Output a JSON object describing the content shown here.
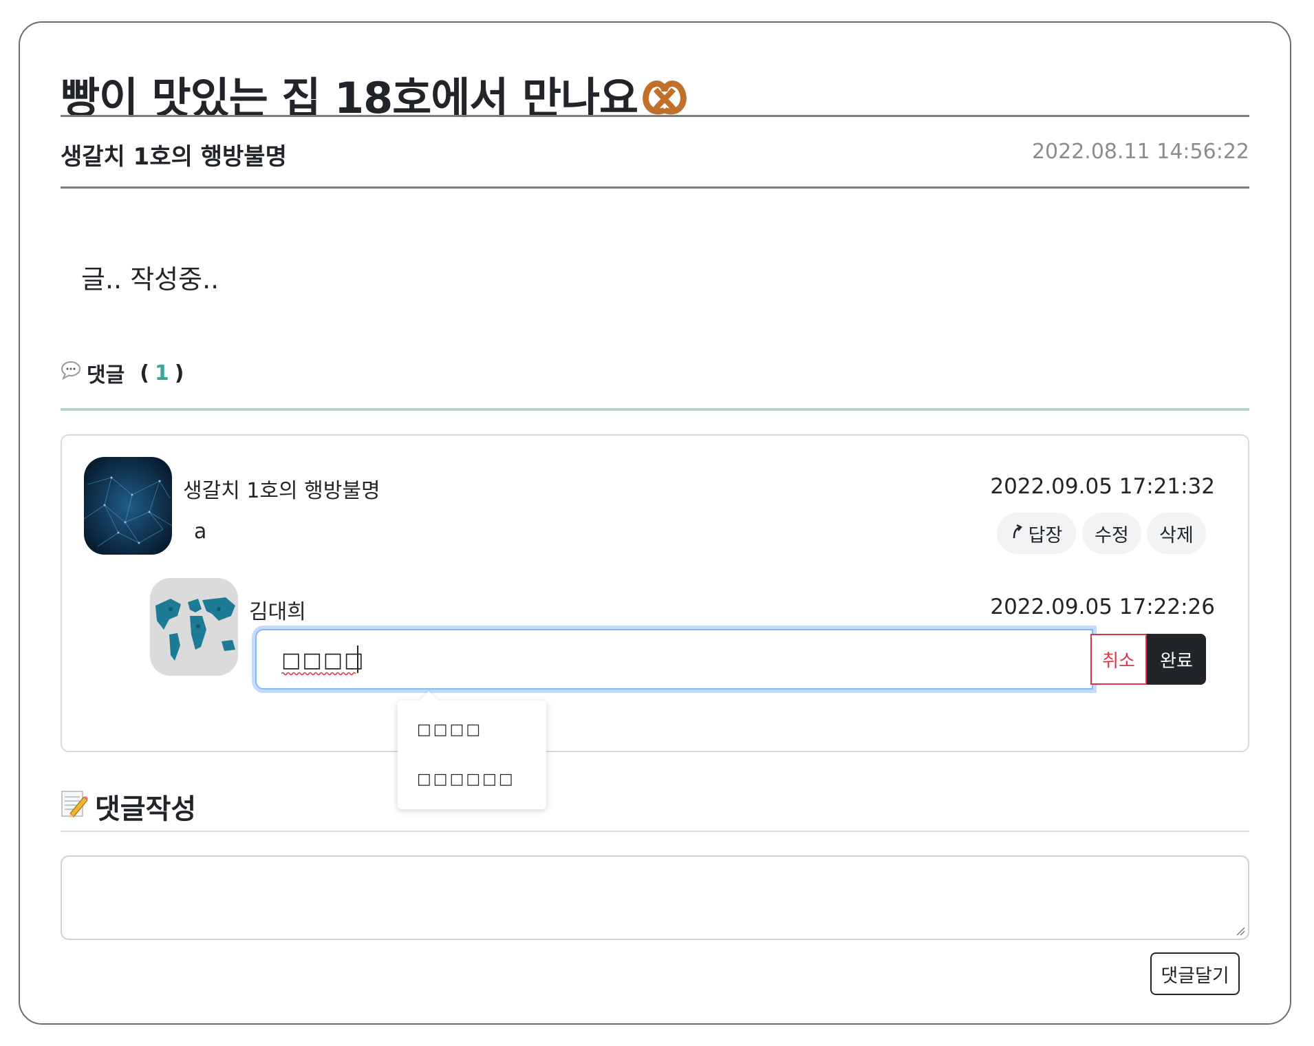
{
  "post": {
    "title": "빵이 맛있는 집 18호에서 만나요",
    "author": "생갈치 1호의 행방불명",
    "date": "2022.08.11 14:56:22",
    "body": "글.. 작성중.."
  },
  "comments_section": {
    "label": "댓글",
    "count_open": "(",
    "count": "1",
    "count_close": ")"
  },
  "comments": [
    {
      "author": "생갈치 1호의 행방불명",
      "date": "2022.09.05 17:21:32",
      "text": "a",
      "actions": {
        "reply": "답장",
        "edit": "수정",
        "delete": "삭제"
      }
    }
  ],
  "reply": {
    "author": "김대희",
    "date": "2022.09.05 17:22:26",
    "edit_value": "□□□□",
    "cancel_label": "취소",
    "done_label": "완료"
  },
  "suggestions": [
    "□□□□",
    "□□□□□□"
  ],
  "write": {
    "heading": "댓글작성",
    "textarea_value": "",
    "submit_label": "댓글달기"
  },
  "colors": {
    "accent_teal": "#3aa59a",
    "danger": "#dc3545",
    "dark": "#212529",
    "focus": "#86b7fe"
  }
}
